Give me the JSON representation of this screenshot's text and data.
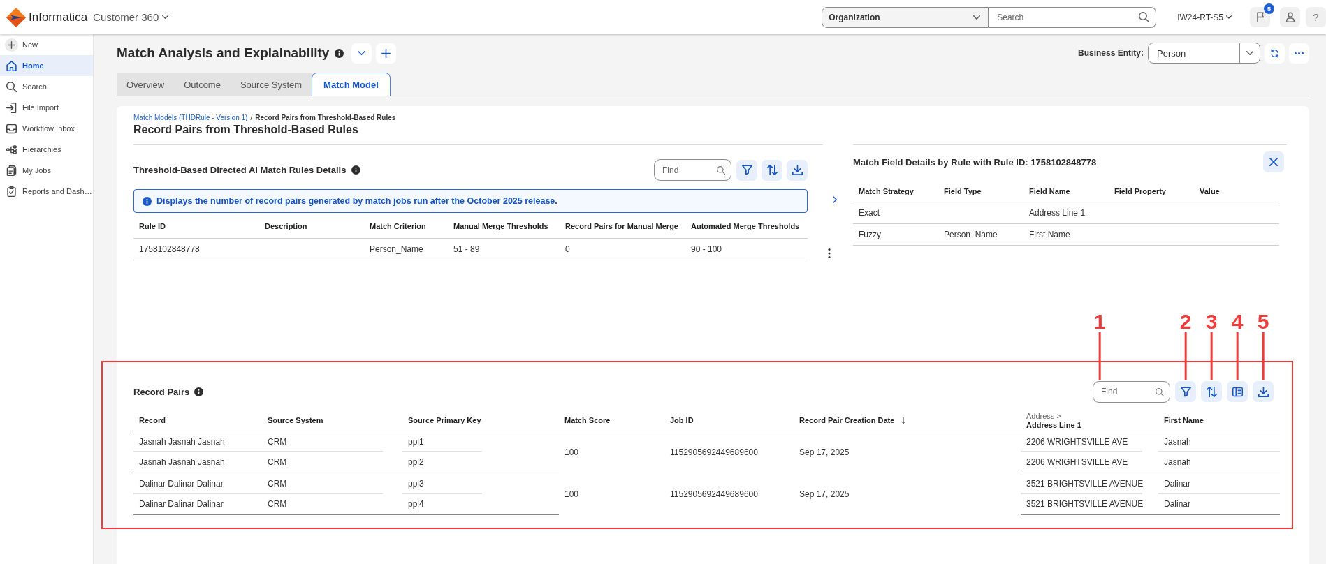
{
  "header": {
    "brand": "Informatica",
    "product": "Customer 360",
    "scope_select": {
      "value": "Organization"
    },
    "search": {
      "placeholder": "Search"
    },
    "environment": "IW24-RT-S5",
    "notification_count": "5",
    "help": "?"
  },
  "sidebar": {
    "items": [
      {
        "kind": "new",
        "label": "New",
        "selected": false
      },
      {
        "kind": "home",
        "label": "Home",
        "selected": true
      },
      {
        "kind": "search",
        "label": "Search",
        "selected": false
      },
      {
        "kind": "import",
        "label": "File Import",
        "selected": false
      },
      {
        "kind": "inbox",
        "label": "Workflow Inbox",
        "selected": false
      },
      {
        "kind": "hierarchy",
        "label": "Hierarchies",
        "selected": false
      },
      {
        "kind": "jobs",
        "label": "My Jobs",
        "selected": false
      },
      {
        "kind": "reports",
        "label": "Reports and Dash…",
        "selected": false
      }
    ]
  },
  "page": {
    "title": "Match Analysis and Explainability",
    "business_entity": {
      "label": "Business Entity:",
      "value": "Person"
    },
    "tabs": [
      {
        "label": "Overview",
        "selected": false
      },
      {
        "label": "Outcome",
        "selected": false
      },
      {
        "label": "Source System",
        "selected": false
      },
      {
        "label": "Match Model",
        "selected": true
      }
    ]
  },
  "breadcrumb": {
    "link": "Match Models (THDRule - Version 1)",
    "separator": "/",
    "current": "Record Pairs from Threshold-Based Rules"
  },
  "heading": "Record Pairs from Threshold-Based Rules",
  "rules": {
    "title": "Threshold-Based Directed AI Match Rules Details",
    "toolbar": [
      {
        "kind": "find",
        "placeholder": "Find"
      },
      {
        "kind": "filter"
      },
      {
        "kind": "sort"
      },
      {
        "kind": "download"
      }
    ],
    "notice": "Displays the number of record pairs generated by match jobs run after the October 2025 release.",
    "table": {
      "columns": [
        "Rule ID",
        "Description",
        "Match Criterion",
        "Manual Merge Thresholds",
        "Record Pairs for Manual Merge",
        "Automated Merge Thresholds"
      ],
      "rows": [
        [
          "1758102848778",
          null,
          "Person_Name",
          "51 - 89",
          "0",
          "90 - 100"
        ]
      ]
    }
  },
  "field_details": {
    "title": "Match Field Details by Rule with Rule ID: 1758102848778",
    "table": {
      "columns": [
        "Match Strategy",
        "Field Type",
        "Field Name",
        "Field Property",
        "Value"
      ],
      "rows": [
        [
          "Exact",
          null,
          "Address Line 1",
          null,
          null
        ],
        [
          "Fuzzy",
          "Person_Name",
          "First Name",
          null,
          null
        ]
      ]
    }
  },
  "record_pairs": {
    "title": "Record Pairs",
    "highlight": true,
    "toolbar": [
      {
        "kind": "find",
        "placeholder": "Find",
        "callout": "1"
      },
      {
        "kind": "filter",
        "callout": "2"
      },
      {
        "kind": "sort",
        "callout": "3"
      },
      {
        "kind": "columns",
        "callout": "4"
      },
      {
        "kind": "download",
        "callout": "5"
      }
    ],
    "table": {
      "columns": [
        {
          "label": "Record",
          "kind": "record",
          "sorted": false
        },
        {
          "label": "Source System",
          "kind": "record",
          "sorted": false
        },
        {
          "label": "Source Primary Key",
          "kind": "record",
          "sorted": false
        },
        {
          "label": "Match Score",
          "kind": "pair",
          "sorted": false
        },
        {
          "label": "Job ID",
          "kind": "pair",
          "sorted": false
        },
        {
          "label": "Record Pair Creation Date",
          "kind": "pair",
          "sorted": true
        },
        {
          "group": "Address >",
          "label": "Address Line 1",
          "kind": "record",
          "sorted": false
        },
        {
          "label": "First Name",
          "kind": "record",
          "sorted": false
        }
      ],
      "pairs": [
        {
          "shared": [
            "100",
            "1152905692449689600",
            "Sep 17, 2025"
          ],
          "records": [
            [
              "Jasnah Jasnah Jasnah",
              "CRM",
              "ppl1",
              "2206 WRIGHTSVILLE AVE",
              "Jasnah"
            ],
            [
              "Jasnah Jasnah Jasnah",
              "CRM",
              "ppl2",
              "2206 WRIGHTSVILLE AVE",
              "Jasnah"
            ]
          ]
        },
        {
          "shared": [
            "100",
            "1152905692449689600",
            "Sep 17, 2025"
          ],
          "records": [
            [
              "Dalinar Dalinar Dalinar",
              "CRM",
              "ppl3",
              "3521 BRIGHTSVILLE AVENUE",
              "Dalinar"
            ],
            [
              "Dalinar Dalinar Dalinar",
              "CRM",
              "ppl4",
              "3521 BRIGHTSVILLE AVENUE",
              "Dalinar"
            ]
          ]
        }
      ]
    }
  }
}
